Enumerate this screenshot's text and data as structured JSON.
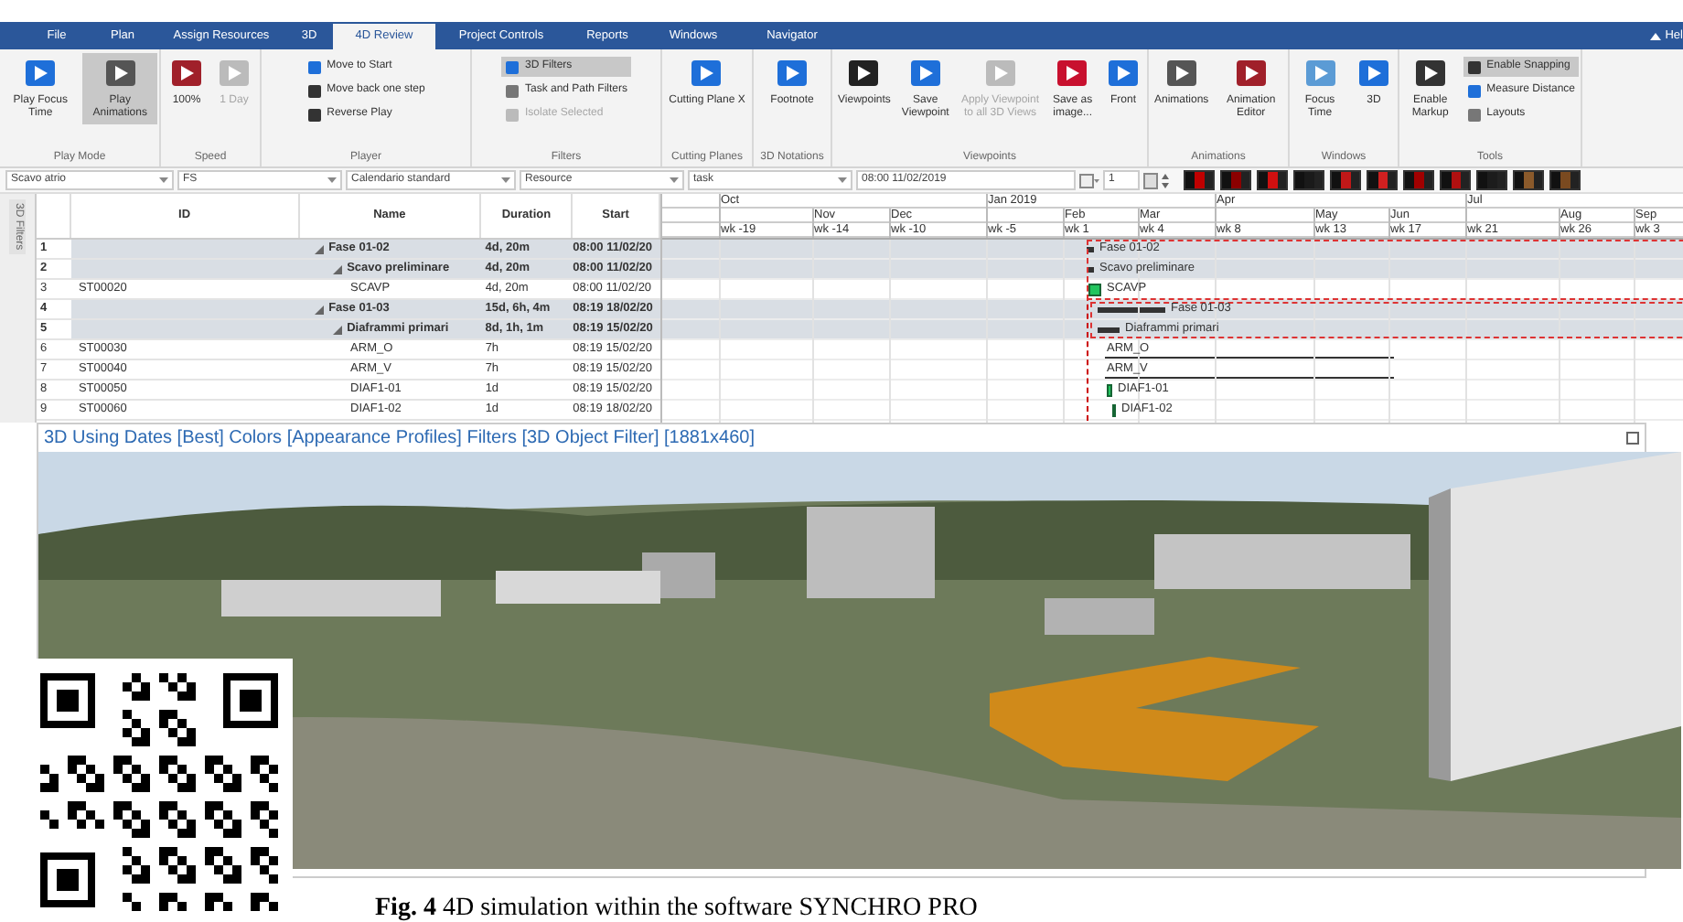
{
  "menu_tabs": [
    {
      "label": "File",
      "selected": false
    },
    {
      "label": "Plan",
      "selected": false
    },
    {
      "label": "Assign Resources",
      "selected": false
    },
    {
      "label": "3D",
      "selected": false
    },
    {
      "label": "4D Review",
      "selected": true
    },
    {
      "label": "Project Controls",
      "selected": false
    },
    {
      "label": "Reports",
      "selected": false
    },
    {
      "label": "Windows",
      "selected": false
    },
    {
      "label": "Navigator",
      "selected": false
    }
  ],
  "help_label": "Hel",
  "ribbon_groups": [
    {
      "label": "Play Mode",
      "items": [
        {
          "kind": "large",
          "label": "Play Focus Time",
          "selected": false,
          "disabled": false
        },
        {
          "kind": "large",
          "label": "Play Animations",
          "selected": true,
          "disabled": false
        }
      ]
    },
    {
      "label": "Speed",
      "items": [
        {
          "kind": "large",
          "label": "100%",
          "selected": false,
          "disabled": false
        },
        {
          "kind": "large",
          "label": "1 Day",
          "selected": false,
          "disabled": true
        }
      ]
    },
    {
      "label": "Player",
      "items": [
        {
          "kind": "small",
          "label": "Move to Start",
          "selected": false,
          "disabled": false
        },
        {
          "kind": "small",
          "label": "Move back one step",
          "selected": false,
          "disabled": false
        },
        {
          "kind": "small",
          "label": "Reverse Play",
          "selected": false,
          "disabled": false
        }
      ]
    },
    {
      "label": "Filters",
      "items": [
        {
          "kind": "small",
          "label": "3D Filters",
          "selected": true,
          "disabled": false
        },
        {
          "kind": "small",
          "label": "Task and Path Filters",
          "selected": false,
          "disabled": false
        },
        {
          "kind": "small",
          "label": "Isolate Selected",
          "selected": false,
          "disabled": true
        }
      ]
    },
    {
      "label": "Cutting Planes",
      "items": [
        {
          "kind": "large",
          "label": "Cutting Plane X",
          "selected": false,
          "disabled": false
        }
      ]
    },
    {
      "label": "3D Notations",
      "items": [
        {
          "kind": "large",
          "label": "Footnote",
          "selected": false,
          "disabled": false
        }
      ]
    },
    {
      "label": "Viewpoints",
      "items": [
        {
          "kind": "large",
          "label": "Viewpoints",
          "selected": false,
          "disabled": false
        },
        {
          "kind": "large",
          "label": "Save Viewpoint",
          "selected": false,
          "disabled": false
        },
        {
          "kind": "large",
          "label": "Apply Viewpoint to all 3D Views",
          "selected": false,
          "disabled": true
        },
        {
          "kind": "large",
          "label": "Save as image...",
          "selected": false,
          "disabled": false
        },
        {
          "kind": "large",
          "label": "Front",
          "selected": false,
          "disabled": false
        }
      ]
    },
    {
      "label": "Animations",
      "items": [
        {
          "kind": "large",
          "label": "Animations",
          "selected": false,
          "disabled": false
        },
        {
          "kind": "large",
          "label": "Animation Editor",
          "selected": false,
          "disabled": false
        }
      ]
    },
    {
      "label": "Windows",
      "items": [
        {
          "kind": "large",
          "label": "Focus Time",
          "selected": false,
          "disabled": false
        },
        {
          "kind": "large",
          "label": "3D",
          "selected": false,
          "disabled": false
        }
      ]
    },
    {
      "label": "Tools",
      "items": [
        {
          "kind": "large",
          "label": "Enable Markup",
          "selected": false,
          "disabled": false
        },
        {
          "kind": "small",
          "label": "Enable Snapping",
          "selected": true,
          "disabled": false
        },
        {
          "kind": "small",
          "label": "Measure Distance",
          "selected": false,
          "disabled": false
        },
        {
          "kind": "small",
          "label": "Layouts",
          "selected": false,
          "disabled": false
        }
      ]
    }
  ],
  "filter_bar": {
    "combos": [
      "Scavo atrio",
      "FS",
      "Calendario standard",
      "Resource",
      "task"
    ],
    "date": "08:00 11/02/2019",
    "step": "1"
  },
  "side_tab": "3D Filters",
  "table": {
    "columns": [
      "ID",
      "Name",
      "Duration",
      "Start"
    ],
    "rows": [
      {
        "number": "1",
        "kind": "summary",
        "name": "Fase 01-02",
        "duration": "4d, 20m",
        "start": "08:00 11/02/20",
        "expanded": true,
        "bar_label": "Fase 01-02",
        "children": [
          {
            "number": "2",
            "kind": "summary",
            "name": "Scavo preliminare",
            "duration": "4d, 20m",
            "start": "08:00 11/02/20",
            "expanded": true,
            "bar_label": "Scavo preliminare",
            "children": [
              {
                "number": "3",
                "kind": "task",
                "id": "ST00020",
                "name": "SCAVP",
                "duration": "4d, 20m",
                "start": "08:00 11/02/20",
                "bar_label": "SCAVP"
              }
            ]
          }
        ]
      },
      {
        "number": "4",
        "kind": "summary",
        "name": "Fase 01-03",
        "duration": "15d, 6h, 4m",
        "start": "08:19 18/02/20",
        "expanded": true,
        "bar_label": "Fase 01-03",
        "children": [
          {
            "number": "5",
            "kind": "summary",
            "name": "Diaframmi primari",
            "duration": "8d, 1h, 1m",
            "start": "08:19 15/02/20",
            "expanded": true,
            "bar_label": "Diaframmi primari",
            "children": [
              {
                "number": "6",
                "kind": "task",
                "id": "ST00030",
                "name": "ARM_O",
                "duration": "7h",
                "start": "08:19 15/02/20",
                "bar_label": "ARM_O"
              },
              {
                "number": "7",
                "kind": "task",
                "id": "ST00040",
                "name": "ARM_V",
                "duration": "7h",
                "start": "08:19 15/02/20",
                "bar_label": "ARM_V"
              },
              {
                "number": "8",
                "kind": "task",
                "id": "ST00050",
                "name": "DIAF1-01",
                "duration": "1d",
                "start": "08:19 15/02/20",
                "bar_label": "DIAF1-01"
              },
              {
                "number": "9",
                "kind": "task",
                "id": "ST00060",
                "name": "DIAF1-02",
                "duration": "1d",
                "start": "08:19 18/02/20",
                "bar_label": "DIAF1-02"
              }
            ]
          }
        ]
      }
    ]
  },
  "timeline": {
    "quarters": [
      "Oct",
      "Jan 2019",
      "Apr",
      "Jul"
    ],
    "months": [
      "Nov",
      "Dec",
      "Feb",
      "Mar",
      "May",
      "Jun",
      "Aug",
      "Sep"
    ],
    "weeks": [
      "wk -19",
      "wk -14",
      "wk -10",
      "wk -5",
      "wk 1",
      "wk 4",
      "wk 8",
      "wk 13",
      "wk 17",
      "wk 21",
      "wk 26",
      "wk 3"
    ]
  },
  "view3d": {
    "title": "3D Using Dates [Best] Colors [Appearance Profiles] Filters [3D Object Filter] [1881x460]"
  },
  "caption": "**Fig. 4** 4D simulation within the software SYNCHRO PRO"
}
